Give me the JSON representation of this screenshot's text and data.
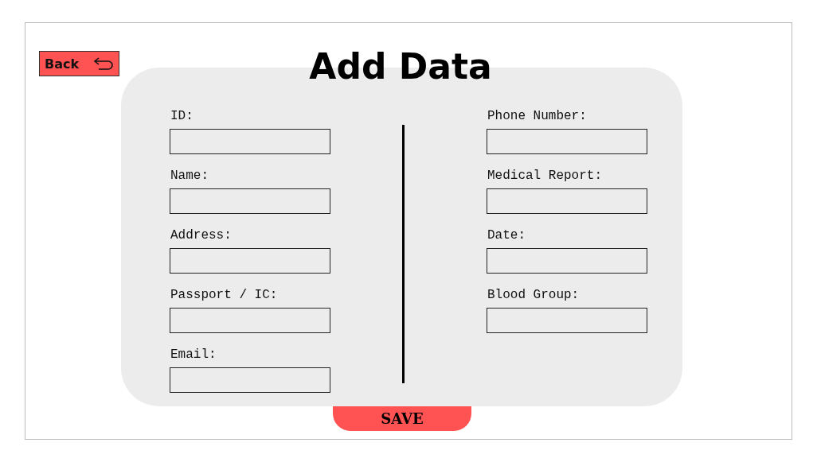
{
  "back_button": {
    "label": "Back"
  },
  "title": "Add Data",
  "form": {
    "columns": [
      {
        "fields": [
          {
            "label": "ID:"
          },
          {
            "label": "Name:"
          },
          {
            "label": "Address:"
          },
          {
            "label": "Passport / IC:"
          },
          {
            "label": "Email:"
          }
        ]
      },
      {
        "fields": [
          {
            "label": "Phone Number:"
          },
          {
            "label": "Medical Report:"
          },
          {
            "label": "Date:"
          },
          {
            "label": "Blood Group:"
          }
        ]
      }
    ]
  },
  "save_button": {
    "label": "SAVE"
  }
}
